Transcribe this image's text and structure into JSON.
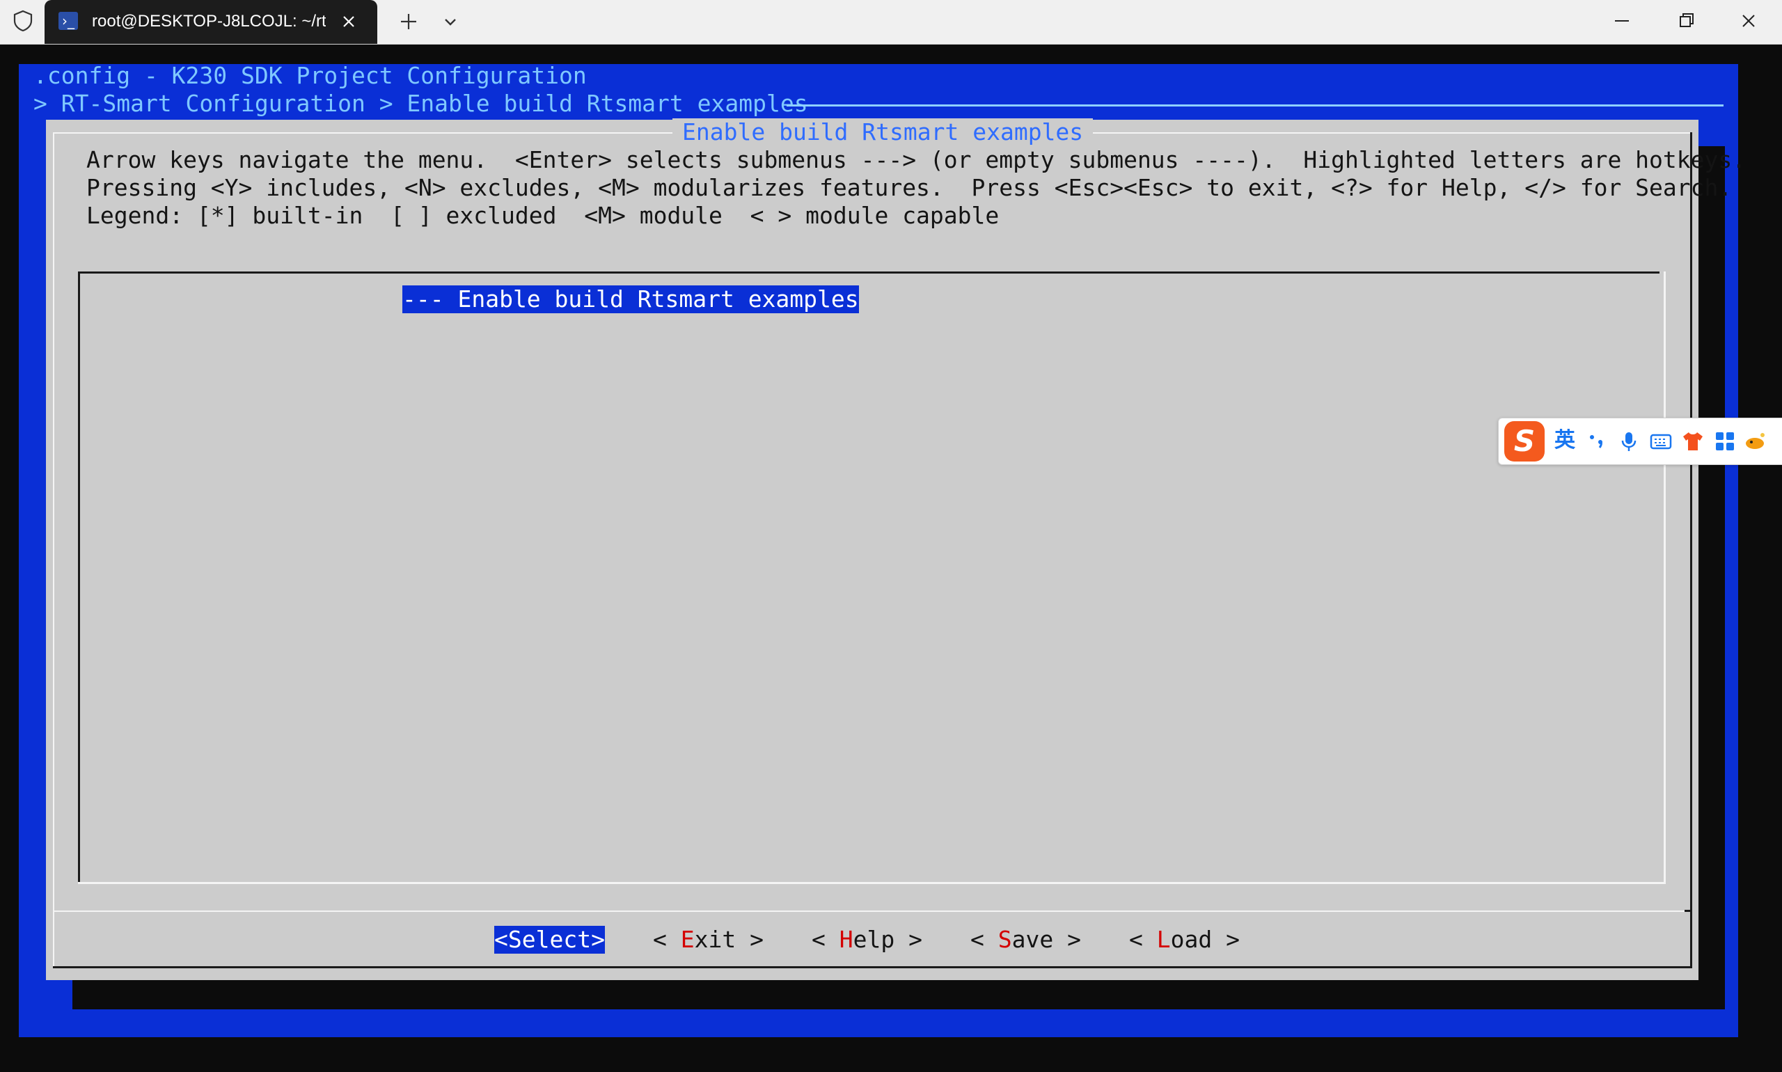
{
  "window": {
    "tab_title": "root@DESKTOP-J8LCOJL: ~/rt",
    "tab_icon": "powershell-icon"
  },
  "terminal": {
    "header_line1": ".config - K230 SDK Project Configuration",
    "header_line2": "> RT-Smart Configuration > Enable build Rtsmart examples",
    "dialog_title": "Enable build Rtsmart examples",
    "help_lines": [
      "Arrow keys navigate the menu.  <Enter> selects submenus ---> (or empty submenus ----).  Highlighted letters are hotkeys.",
      "Pressing <Y> includes, <N> excludes, <M> modularizes features.  Press <Esc><Esc> to exit, <?> for Help, </> for Search.",
      "Legend: [*] built-in  [ ] excluded  <M> module  < > module capable"
    ],
    "menu_items": [
      {
        "text": "--- Enable build Rtsmart examples",
        "selected": true
      }
    ],
    "buttons": [
      {
        "pre": "<",
        "hotkey": "",
        "rest": "Select",
        "post": ">",
        "selected": true
      },
      {
        "pre": "< ",
        "hotkey": "E",
        "rest": "xit",
        "post": " >",
        "selected": false
      },
      {
        "pre": "< ",
        "hotkey": "H",
        "rest": "elp",
        "post": " >",
        "selected": false
      },
      {
        "pre": "< ",
        "hotkey": "S",
        "rest": "ave",
        "post": " >",
        "selected": false
      },
      {
        "pre": "< ",
        "hotkey": "L",
        "rest": "oad",
        "post": " >",
        "selected": false
      }
    ]
  },
  "ime": {
    "logo": "S",
    "lang": "英",
    "icons": [
      "punctuation-icon",
      "microphone-icon",
      "keyboard-icon",
      "skin-shirt-icon",
      "toolbox-grid-icon",
      "mascot-icon"
    ]
  },
  "colors": {
    "terminal_blue": "#0a2fd6",
    "dialog_gray": "#cccccc",
    "hotkey_red": "#d40000",
    "header_text": "#7fc8ff"
  }
}
